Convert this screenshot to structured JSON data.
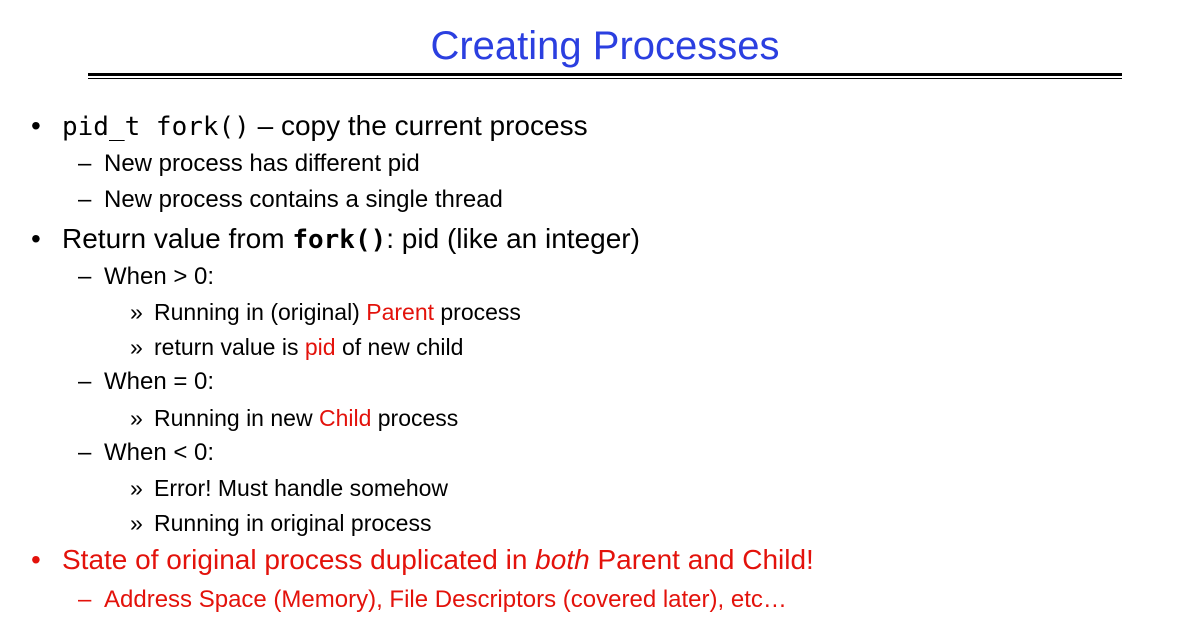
{
  "slide": {
    "title": "Creating Processes",
    "markers": {
      "bullet": "•",
      "dash": "–",
      "sub": "»"
    },
    "b1": {
      "code": "pid_t fork()",
      "text": " – copy the current process",
      "subs": [
        "New process has different pid",
        "New process contains a single thread"
      ]
    },
    "b2": {
      "before": "Return value from ",
      "code": "fork()",
      "after": ": pid (like an integer)",
      "when_gt": {
        "label": "When > 0:",
        "items": [
          {
            "before": "Running in (original) ",
            "highlight": "Parent",
            "after": " process"
          },
          {
            "before": "return value is ",
            "highlight": "pid",
            "after": " of new child"
          }
        ]
      },
      "when_eq": {
        "label": "When = 0:",
        "items": [
          {
            "before": "Running in new ",
            "highlight": "Child",
            "after": " process"
          }
        ]
      },
      "when_lt": {
        "label": "When < 0:",
        "items": [
          "Error!  Must handle somehow",
          "Running in original process"
        ]
      }
    },
    "b3": {
      "before": "State of original process duplicated in ",
      "emph": "both",
      "after": " Parent and Child!",
      "sub": "Address Space (Memory), File Descriptors (covered later), etc…"
    },
    "colors": {
      "title": "#2b3fe0",
      "highlight": "#e3120b",
      "text": "#000000"
    }
  }
}
